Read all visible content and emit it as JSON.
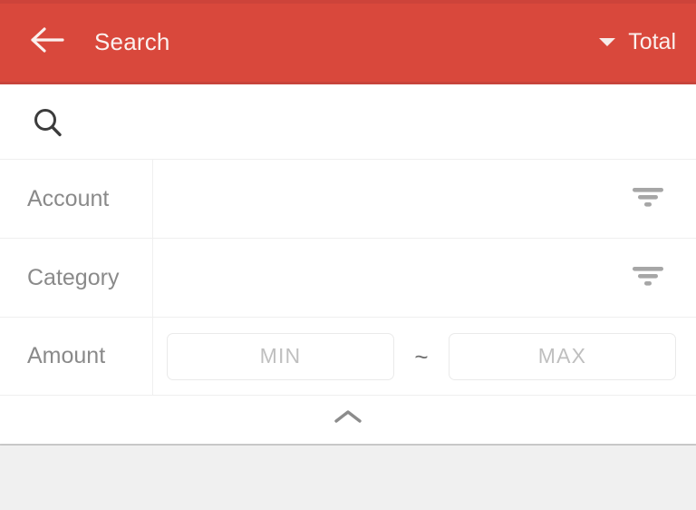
{
  "app": {
    "accent_color": "#d9483c",
    "accent_color_dark": "#cd433a",
    "card_background": "#ffffff",
    "content_background": "#f0f0f0",
    "label_color": "#8a8a8a",
    "placeholder_color": "#bfbfbf"
  },
  "appbar": {
    "back_icon": "arrow-left-icon",
    "title": "Search",
    "menu": {
      "caret_icon": "caret-down-icon",
      "label": "Total"
    }
  },
  "filter_panel": {
    "search": {
      "icon": "search-icon",
      "value": "",
      "placeholder": ""
    },
    "rows": [
      {
        "label": "Account",
        "value": "",
        "action_icon": "filter-list-icon"
      },
      {
        "label": "Category",
        "value": "",
        "action_icon": "filter-list-icon"
      }
    ],
    "amount": {
      "label": "Amount",
      "min": {
        "value": "",
        "placeholder": "MIN"
      },
      "separator": "~",
      "max": {
        "value": "",
        "placeholder": "MAX"
      }
    },
    "collapse": {
      "icon": "chevron-up-icon"
    }
  },
  "results": {
    "items": []
  }
}
